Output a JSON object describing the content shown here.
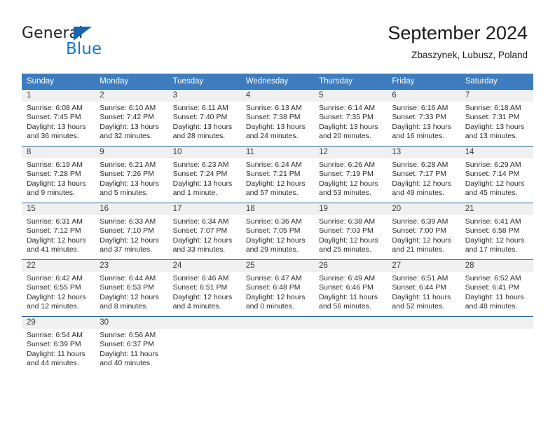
{
  "brand": {
    "word_top": "General",
    "word_bottom": "Blue",
    "triangle_icon": "brand-triangle-icon",
    "color_top": "#231f20",
    "color_bottom": "#1577cf"
  },
  "header": {
    "title": "September 2024",
    "subtitle": "Zbaszynek, Lubusz, Poland"
  },
  "theme": {
    "header_blue": "#3c7cbf",
    "grid_line": "#2a6099",
    "daynum_band": "#f0f0f0"
  },
  "weekdays": [
    "Sunday",
    "Monday",
    "Tuesday",
    "Wednesday",
    "Thursday",
    "Friday",
    "Saturday"
  ],
  "weeks": [
    [
      {
        "day": "1",
        "sunrise": "Sunrise: 6:08 AM",
        "sunset": "Sunset: 7:45 PM",
        "daylight_line1": "Daylight: 13 hours",
        "daylight_line2": "and 36 minutes."
      },
      {
        "day": "2",
        "sunrise": "Sunrise: 6:10 AM",
        "sunset": "Sunset: 7:42 PM",
        "daylight_line1": "Daylight: 13 hours",
        "daylight_line2": "and 32 minutes."
      },
      {
        "day": "3",
        "sunrise": "Sunrise: 6:11 AM",
        "sunset": "Sunset: 7:40 PM",
        "daylight_line1": "Daylight: 13 hours",
        "daylight_line2": "and 28 minutes."
      },
      {
        "day": "4",
        "sunrise": "Sunrise: 6:13 AM",
        "sunset": "Sunset: 7:38 PM",
        "daylight_line1": "Daylight: 13 hours",
        "daylight_line2": "and 24 minutes."
      },
      {
        "day": "5",
        "sunrise": "Sunrise: 6:14 AM",
        "sunset": "Sunset: 7:35 PM",
        "daylight_line1": "Daylight: 13 hours",
        "daylight_line2": "and 20 minutes."
      },
      {
        "day": "6",
        "sunrise": "Sunrise: 6:16 AM",
        "sunset": "Sunset: 7:33 PM",
        "daylight_line1": "Daylight: 13 hours",
        "daylight_line2": "and 16 minutes."
      },
      {
        "day": "7",
        "sunrise": "Sunrise: 6:18 AM",
        "sunset": "Sunset: 7:31 PM",
        "daylight_line1": "Daylight: 13 hours",
        "daylight_line2": "and 13 minutes."
      }
    ],
    [
      {
        "day": "8",
        "sunrise": "Sunrise: 6:19 AM",
        "sunset": "Sunset: 7:28 PM",
        "daylight_line1": "Daylight: 13 hours",
        "daylight_line2": "and 9 minutes."
      },
      {
        "day": "9",
        "sunrise": "Sunrise: 6:21 AM",
        "sunset": "Sunset: 7:26 PM",
        "daylight_line1": "Daylight: 13 hours",
        "daylight_line2": "and 5 minutes."
      },
      {
        "day": "10",
        "sunrise": "Sunrise: 6:23 AM",
        "sunset": "Sunset: 7:24 PM",
        "daylight_line1": "Daylight: 13 hours",
        "daylight_line2": "and 1 minute."
      },
      {
        "day": "11",
        "sunrise": "Sunrise: 6:24 AM",
        "sunset": "Sunset: 7:21 PM",
        "daylight_line1": "Daylight: 12 hours",
        "daylight_line2": "and 57 minutes."
      },
      {
        "day": "12",
        "sunrise": "Sunrise: 6:26 AM",
        "sunset": "Sunset: 7:19 PM",
        "daylight_line1": "Daylight: 12 hours",
        "daylight_line2": "and 53 minutes."
      },
      {
        "day": "13",
        "sunrise": "Sunrise: 6:28 AM",
        "sunset": "Sunset: 7:17 PM",
        "daylight_line1": "Daylight: 12 hours",
        "daylight_line2": "and 49 minutes."
      },
      {
        "day": "14",
        "sunrise": "Sunrise: 6:29 AM",
        "sunset": "Sunset: 7:14 PM",
        "daylight_line1": "Daylight: 12 hours",
        "daylight_line2": "and 45 minutes."
      }
    ],
    [
      {
        "day": "15",
        "sunrise": "Sunrise: 6:31 AM",
        "sunset": "Sunset: 7:12 PM",
        "daylight_line1": "Daylight: 12 hours",
        "daylight_line2": "and 41 minutes."
      },
      {
        "day": "16",
        "sunrise": "Sunrise: 6:33 AM",
        "sunset": "Sunset: 7:10 PM",
        "daylight_line1": "Daylight: 12 hours",
        "daylight_line2": "and 37 minutes."
      },
      {
        "day": "17",
        "sunrise": "Sunrise: 6:34 AM",
        "sunset": "Sunset: 7:07 PM",
        "daylight_line1": "Daylight: 12 hours",
        "daylight_line2": "and 33 minutes."
      },
      {
        "day": "18",
        "sunrise": "Sunrise: 6:36 AM",
        "sunset": "Sunset: 7:05 PM",
        "daylight_line1": "Daylight: 12 hours",
        "daylight_line2": "and 29 minutes."
      },
      {
        "day": "19",
        "sunrise": "Sunrise: 6:38 AM",
        "sunset": "Sunset: 7:03 PM",
        "daylight_line1": "Daylight: 12 hours",
        "daylight_line2": "and 25 minutes."
      },
      {
        "day": "20",
        "sunrise": "Sunrise: 6:39 AM",
        "sunset": "Sunset: 7:00 PM",
        "daylight_line1": "Daylight: 12 hours",
        "daylight_line2": "and 21 minutes."
      },
      {
        "day": "21",
        "sunrise": "Sunrise: 6:41 AM",
        "sunset": "Sunset: 6:58 PM",
        "daylight_line1": "Daylight: 12 hours",
        "daylight_line2": "and 17 minutes."
      }
    ],
    [
      {
        "day": "22",
        "sunrise": "Sunrise: 6:42 AM",
        "sunset": "Sunset: 6:55 PM",
        "daylight_line1": "Daylight: 12 hours",
        "daylight_line2": "and 12 minutes."
      },
      {
        "day": "23",
        "sunrise": "Sunrise: 6:44 AM",
        "sunset": "Sunset: 6:53 PM",
        "daylight_line1": "Daylight: 12 hours",
        "daylight_line2": "and 8 minutes."
      },
      {
        "day": "24",
        "sunrise": "Sunrise: 6:46 AM",
        "sunset": "Sunset: 6:51 PM",
        "daylight_line1": "Daylight: 12 hours",
        "daylight_line2": "and 4 minutes."
      },
      {
        "day": "25",
        "sunrise": "Sunrise: 6:47 AM",
        "sunset": "Sunset: 6:48 PM",
        "daylight_line1": "Daylight: 12 hours",
        "daylight_line2": "and 0 minutes."
      },
      {
        "day": "26",
        "sunrise": "Sunrise: 6:49 AM",
        "sunset": "Sunset: 6:46 PM",
        "daylight_line1": "Daylight: 11 hours",
        "daylight_line2": "and 56 minutes."
      },
      {
        "day": "27",
        "sunrise": "Sunrise: 6:51 AM",
        "sunset": "Sunset: 6:44 PM",
        "daylight_line1": "Daylight: 11 hours",
        "daylight_line2": "and 52 minutes."
      },
      {
        "day": "28",
        "sunrise": "Sunrise: 6:52 AM",
        "sunset": "Sunset: 6:41 PM",
        "daylight_line1": "Daylight: 11 hours",
        "daylight_line2": "and 48 minutes."
      }
    ],
    [
      {
        "day": "29",
        "sunrise": "Sunrise: 6:54 AM",
        "sunset": "Sunset: 6:39 PM",
        "daylight_line1": "Daylight: 11 hours",
        "daylight_line2": "and 44 minutes."
      },
      {
        "day": "30",
        "sunrise": "Sunrise: 6:56 AM",
        "sunset": "Sunset: 6:37 PM",
        "daylight_line1": "Daylight: 11 hours",
        "daylight_line2": "and 40 minutes."
      },
      {
        "day": "",
        "sunrise": "",
        "sunset": "",
        "daylight_line1": "",
        "daylight_line2": ""
      },
      {
        "day": "",
        "sunrise": "",
        "sunset": "",
        "daylight_line1": "",
        "daylight_line2": ""
      },
      {
        "day": "",
        "sunrise": "",
        "sunset": "",
        "daylight_line1": "",
        "daylight_line2": ""
      },
      {
        "day": "",
        "sunrise": "",
        "sunset": "",
        "daylight_line1": "",
        "daylight_line2": ""
      },
      {
        "day": "",
        "sunrise": "",
        "sunset": "",
        "daylight_line1": "",
        "daylight_line2": ""
      }
    ]
  ]
}
